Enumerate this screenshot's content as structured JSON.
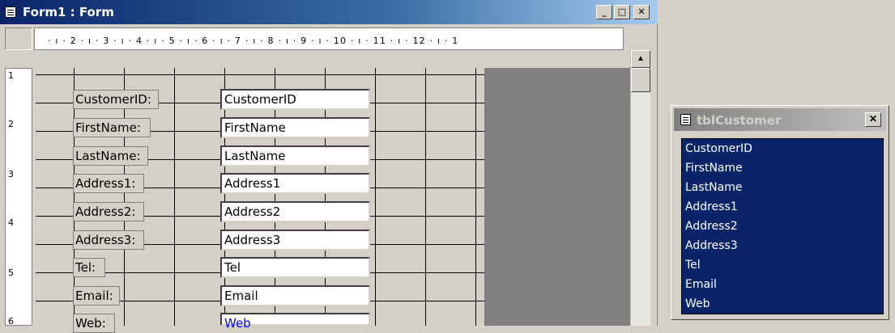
{
  "window": {
    "title": "Form1 : Form",
    "min_label": "_",
    "max_label": "□",
    "close_label": "✕"
  },
  "ruler": {
    "h_ticks": [
      "· ı · 2 · ı · 3 · ı · 4 · ı · 5 · ı · 6 · ı · 7 · ı · 8 · ı · 9 · ı · 10 · ı · 11 · ı · 12 · ı · 1"
    ],
    "v_ticks": [
      "1",
      "2",
      "3",
      "4",
      "5",
      "6"
    ]
  },
  "form": {
    "labels": [
      "CustomerID:",
      "FirstName:",
      "LastName:",
      "Address1:",
      "Address2:",
      "Address3:",
      "Tel:",
      "Email:",
      "Web:"
    ],
    "fields": [
      "CustomerID",
      "FirstName",
      "LastName",
      "Address1",
      "Address2",
      "Address3",
      "Tel",
      "Email",
      "Web"
    ]
  },
  "field_list": {
    "title": "tblCustomer",
    "close_label": "✕",
    "items": [
      "CustomerID",
      "FirstName",
      "LastName",
      "Address1",
      "Address2",
      "Address3",
      "Tel",
      "Email",
      "Web"
    ]
  },
  "colors": {
    "titlebar": "#0a246a",
    "selection": "#0a246a",
    "web_text": "#0000ff"
  }
}
